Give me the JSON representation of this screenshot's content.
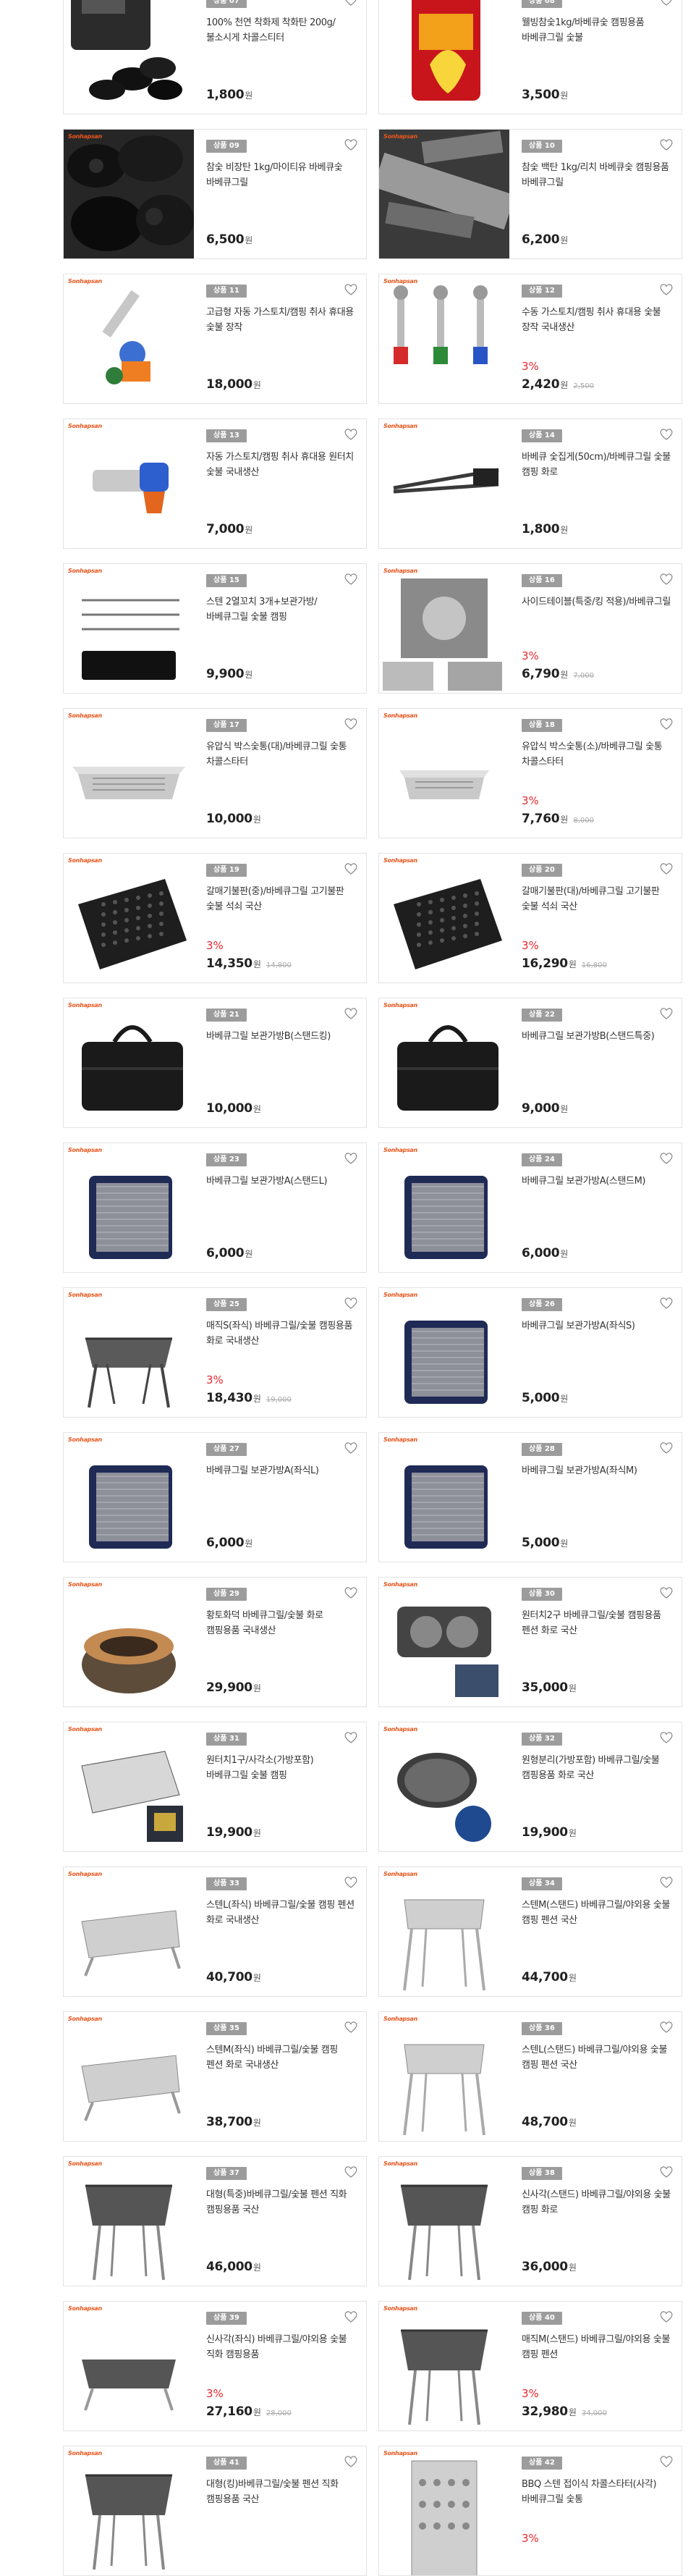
{
  "brand_logo": "Sonhapsan",
  "currency_unit": "원",
  "accent_color": "#e8292e",
  "badge_color": "#9c9c9c",
  "products": [
    {
      "badge": "상품 07",
      "name": "100% 천연 착화제 착화탄 200g/불소시게 차콜스티터",
      "discount": "",
      "price": "1,800",
      "original_price": "",
      "image": "black-charcoal-bag"
    },
    {
      "badge": "상품 08",
      "name": "웰빙참숯1kg/바베큐숯 캠핑용품 바베큐그릴 숯불",
      "discount": "",
      "price": "3,500",
      "image": "red-charcoal-bag"
    },
    {
      "badge": "상품 09",
      "name": "참숯 비장탄 1kg/마이티유 바베큐숯 바베큐그릴",
      "discount": "",
      "price": "6,500",
      "original_price": "",
      "image": "charcoal-lumps"
    },
    {
      "badge": "상품 10",
      "name": "참숯 백탄 1kg/리치 바베큐숯 캠핑용품 바베큐그릴",
      "discount": "",
      "price": "6,200",
      "original_price": "",
      "image": "white-charcoal-log"
    },
    {
      "badge": "상품 11",
      "name": "고급형 자동 가스토치/캠핑 취사 휴대용 숯불 장작",
      "discount": "",
      "price": "18,000",
      "original_price": "",
      "image": "gas-torch-single"
    },
    {
      "badge": "상품 12",
      "name": "수동 가스토치/캠핑 취사 휴대용 숯불 장작 국내생산",
      "discount": "3%",
      "price": "2,420",
      "original_price": "2,500",
      "image": "gas-torch-triple"
    },
    {
      "badge": "상품 13",
      "name": "자동 가스토치/캠핑 취사 휴대용 원터치 숯불 국내생산",
      "discount": "",
      "price": "7,000",
      "original_price": "",
      "image": "gas-torch-blue"
    },
    {
      "badge": "상품 14",
      "name": "바베큐 숯집게(50cm)/바베큐그릴 숯불 캠핑 화로",
      "discount": "",
      "price": "1,800",
      "original_price": "",
      "image": "tongs"
    },
    {
      "badge": "상품 15",
      "name": "스텐 2열꼬치 3개+보관가방/바베큐그릴 숯불 캠핑",
      "discount": "",
      "price": "9,900",
      "original_price": "",
      "image": "skewers"
    },
    {
      "badge": "상품 16",
      "name": "사이드테이블(특중/킹 적용)/바베큐그릴",
      "discount": "3%",
      "price": "6,790",
      "original_price": "7,000",
      "image": "side-table"
    },
    {
      "badge": "상품 17",
      "name": "유압식 박스숯통(대)/바베큐그릴 숯통 차콜스타터",
      "discount": "",
      "price": "10,000",
      "original_price": "",
      "image": "tray-large"
    },
    {
      "badge": "상품 18",
      "name": "유압식 박스숯통(소)/바베큐그릴 숯통 차콜스타터",
      "discount": "3%",
      "price": "7,760",
      "original_price": "8,000",
      "image": "tray-small"
    },
    {
      "badge": "상품 19",
      "name": "갈매기불판(중)/바베큐그릴 고기불판 숯불 석쇠 국산",
      "discount": "3%",
      "price": "14,350",
      "original_price": "14,800",
      "image": "grill-plate"
    },
    {
      "badge": "상품 20",
      "name": "갈매기불판(대)/바베큐그릴 고기불판 숯불 석쇠 국산",
      "discount": "3%",
      "price": "16,290",
      "original_price": "16,800",
      "image": "grill-plate"
    },
    {
      "badge": "상품 21",
      "name": "바베큐그릴 보관가방B(스탠드킹)",
      "discount": "",
      "price": "10,000",
      "original_price": "",
      "image": "black-bag"
    },
    {
      "badge": "상품 22",
      "name": "바베큐그릴 보관가방B(스탠드특중)",
      "discount": "",
      "price": "9,000",
      "original_price": "",
      "image": "black-bag"
    },
    {
      "badge": "상품 23",
      "name": "바베큐그릴 보관가방A(스탠드L)",
      "discount": "",
      "price": "6,000",
      "original_price": "",
      "image": "navy-bag"
    },
    {
      "badge": "상품 24",
      "name": "바베큐그릴 보관가방A(스탠드M)",
      "discount": "",
      "price": "6,000",
      "original_price": "",
      "image": "navy-bag"
    },
    {
      "badge": "상품 25",
      "name": "매직S(좌식) 바베큐그릴/숯불 캠핑용품 화로 국내생산",
      "discount": "3%",
      "price": "18,430",
      "original_price": "19,000",
      "image": "grill-folding"
    },
    {
      "badge": "상품 26",
      "name": "바베큐그릴 보관가방A(좌식S)",
      "discount": "",
      "price": "5,000",
      "original_price": "",
      "image": "navy-bag"
    },
    {
      "badge": "상품 27",
      "name": "바베큐그릴 보관가방A(좌식L)",
      "discount": "",
      "price": "6,000",
      "original_price": "",
      "image": "navy-bag"
    },
    {
      "badge": "상품 28",
      "name": "바베큐그릴 보관가방A(좌식M)",
      "discount": "",
      "price": "5,000",
      "original_price": "",
      "image": "navy-bag"
    },
    {
      "badge": "상품 29",
      "name": "황토화덕 바베큐그릴/숯불 화로 캠핑용품 국내생산",
      "discount": "",
      "price": "29,900",
      "original_price": "",
      "image": "clay-brazier"
    },
    {
      "badge": "상품 30",
      "name": "원터치2구 바베큐그릴/숯불 캠핑용품 펜션 화로 국산",
      "discount": "",
      "price": "35,000",
      "original_price": "",
      "image": "grill-double"
    },
    {
      "badge": "상품 31",
      "name": "원터치1구/사각소(가방포함) 바베큐그릴 숯불 캠핑",
      "discount": "",
      "price": "19,900",
      "original_price": "",
      "image": "grill-square"
    },
    {
      "badge": "상품 32",
      "name": "원형분리(가방포함) 바베큐그릴/숯불 캠핑용품 화로 국산",
      "discount": "",
      "price": "19,900",
      "original_price": "",
      "image": "grill-round"
    },
    {
      "badge": "상품 33",
      "name": "스텐L(좌식) 바베큐그릴/숯불 캠핑 펜션 화로 국내생산",
      "discount": "",
      "price": "40,700",
      "original_price": "",
      "image": "steel-box-low"
    },
    {
      "badge": "상품 34",
      "name": "스텐M(스탠드) 바베큐그릴/야외용 숯불 캠핑 펜션 국산",
      "discount": "",
      "price": "44,700",
      "original_price": "",
      "image": "steel-stand"
    },
    {
      "badge": "상품 35",
      "name": "스텐M(좌식) 바베큐그릴/숯불 캠핑 펜션 화로 국내생산",
      "discount": "",
      "price": "38,700",
      "original_price": "",
      "image": "steel-box-low"
    },
    {
      "badge": "상품 36",
      "name": "스텐L(스탠드) 바베큐그릴/야외용 숯불 캠핑 펜션 국산",
      "discount": "",
      "price": "48,700",
      "original_price": "",
      "image": "steel-stand"
    },
    {
      "badge": "상품 37",
      "name": "대형(특중)바베큐그릴/숯불 펜션 직화 캠핑용품 국산",
      "discount": "",
      "price": "46,000",
      "original_price": "",
      "image": "dark-stand"
    },
    {
      "badge": "상품 38",
      "name": "신사각(스탠드) 바베큐그릴/야외용 숯불 캠핑 화로",
      "discount": "",
      "price": "36,000",
      "original_price": "",
      "image": "dark-stand"
    },
    {
      "badge": "상품 39",
      "name": "신사각(좌식) 바베큐그릴/야외용 숯불 직화 캠핑용품",
      "discount": "3%",
      "price": "27,160",
      "original_price": "28,000",
      "image": "dark-low"
    },
    {
      "badge": "상품 40",
      "name": "매직M(스탠드) 바베큐그릴/야외용 숯불 캠핑 펜션",
      "discount": "3%",
      "price": "32,980",
      "original_price": "34,000",
      "image": "dark-stand"
    },
    {
      "badge": "상품 41",
      "name": "대형(킹)바베큐그릴/숯불 펜션 직화 캠핑용품 국산",
      "discount": "",
      "price": "",
      "original_price": "",
      "image": "dark-stand"
    },
    {
      "badge": "상품 42",
      "name": "BBQ 스텐 접이식 차콜스타터(사각) 바베큐그릴 숯통",
      "discount": "3%",
      "price": "",
      "original_price": "",
      "image": "chimney-starter"
    }
  ]
}
